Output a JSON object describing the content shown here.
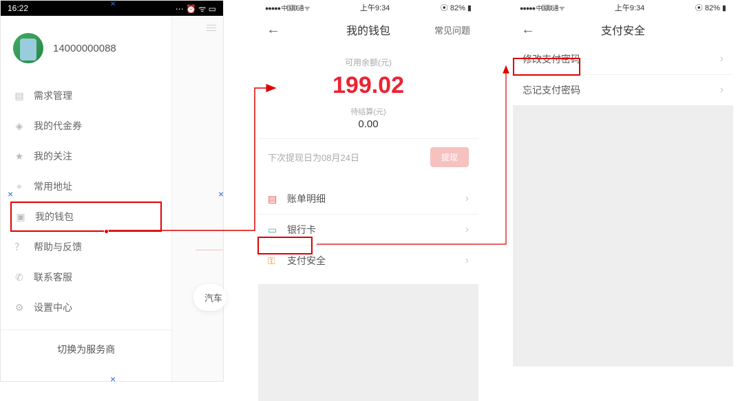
{
  "screen1": {
    "statusbar": {
      "time": "16:22",
      "icons": "⋯ ⏰ ᯤ ▭"
    },
    "phone": "14000000088",
    "menu": [
      {
        "icon": "▤",
        "label": "需求管理"
      },
      {
        "icon": "◈",
        "label": "我的代金券"
      },
      {
        "icon": "★",
        "label": "我的关注"
      },
      {
        "icon": "⌖",
        "label": "常用地址"
      },
      {
        "icon": "▣",
        "label": "我的钱包"
      },
      {
        "icon": "？",
        "label": "帮助与反馈"
      },
      {
        "icon": "✆",
        "label": "联系客服"
      },
      {
        "icon": "⚙",
        "label": "设置中心"
      }
    ],
    "switch": "切换为服务商",
    "chip": "汽车"
  },
  "screen2": {
    "statusbar": {
      "signal": "●●●●● 中国联通 ᯤ",
      "time": "上午9:34",
      "battery": "⦿ 82% ▮"
    },
    "nav": {
      "title": "我的钱包",
      "right": "常见问题"
    },
    "balance": {
      "label": "可用余额(元)",
      "amount": "199.02",
      "pending_label": "待结算(元)",
      "pending_amount": "0.00"
    },
    "withdraw": {
      "note": "下次提现日为08月24日",
      "btn": "提现"
    },
    "list": [
      {
        "icon": "#e55",
        "glyph": "▤",
        "label": "账单明细"
      },
      {
        "icon": "#4a9",
        "glyph": "▭",
        "label": "银行卡"
      },
      {
        "icon": "#e80",
        "glyph": "⚿",
        "label": "支付安全"
      }
    ]
  },
  "screen3": {
    "statusbar": {
      "signal": "●●●●● 中国联通 ᯤ",
      "time": "上午9:34",
      "battery": "⦿ 82% ▮"
    },
    "nav": {
      "title": "支付安全"
    },
    "list": [
      {
        "label": "修改支付密码"
      },
      {
        "label": "忘记支付密码"
      }
    ]
  }
}
